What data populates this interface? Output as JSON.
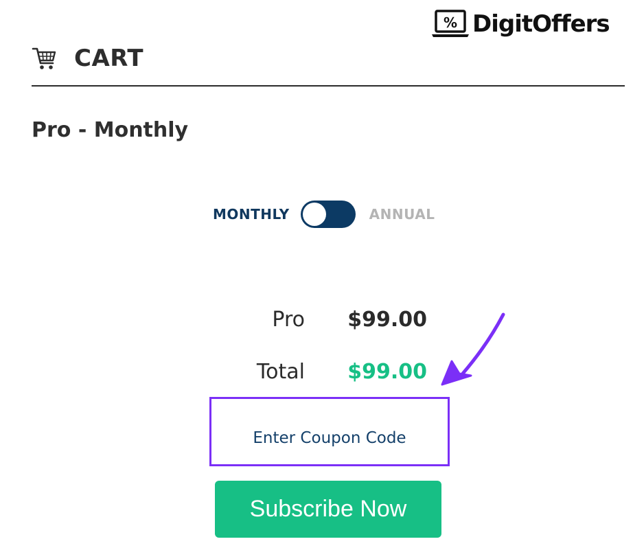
{
  "brand": {
    "logo_text": "DigitOffers",
    "logo_icon": "percent-laptop-icon"
  },
  "cart": {
    "title": "CART",
    "icon": "shopping-cart-icon"
  },
  "plan": {
    "name": "Pro - Monthly"
  },
  "billing_toggle": {
    "left_label": "MONTHLY",
    "right_label": "ANNUAL",
    "selected": "MONTHLY"
  },
  "summary": {
    "line_label": "Pro",
    "line_value": "$99.00",
    "total_label": "Total",
    "total_value": "$99.00"
  },
  "coupon": {
    "placeholder": "Enter Coupon Code",
    "value": ""
  },
  "subscribe": {
    "label": "Subscribe Now"
  },
  "annotation": {
    "icon": "arrow-pointer-icon"
  },
  "colors": {
    "accent_green": "#17bf85",
    "toggle_navy": "#0c3a64",
    "highlight_purple": "#7b2ff7",
    "inactive_gray": "#b4b4b4"
  }
}
